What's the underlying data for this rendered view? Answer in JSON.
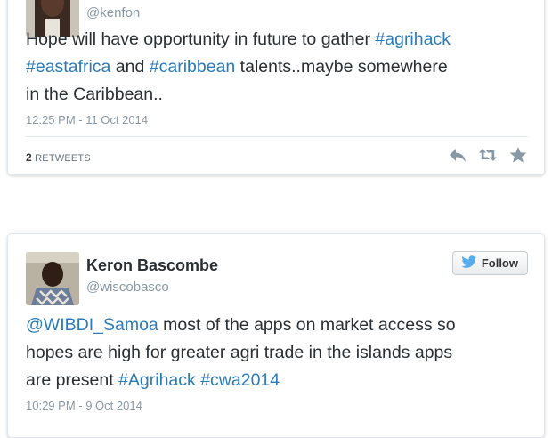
{
  "tweets": [
    {
      "username": "@kenfon",
      "text_parts": [
        {
          "t": "Hope will have opportunity in future to gather ",
          "link": false
        },
        {
          "t": "#agrihack",
          "link": true
        },
        {
          "t": "\n",
          "link": false
        },
        {
          "t": "#eastafrica",
          "link": true
        },
        {
          "t": " and ",
          "link": false
        },
        {
          "t": "#caribbean",
          "link": true
        },
        {
          "t": " talents..maybe somewhere\nin the Caribbean..",
          "link": false
        }
      ],
      "timestamp": "12:25 PM - 11 Oct 2014",
      "retweet_count": "2",
      "retweet_label": "RETWEETS",
      "actions": [
        "reply-icon",
        "retweet-icon",
        "favorite-icon"
      ]
    },
    {
      "display_name": "Keron Bascombe",
      "username": "@wiscobasco",
      "follow_label": "Follow",
      "text_parts": [
        {
          "t": "@WIBDI_Samoa",
          "link": true
        },
        {
          "t": " most of the apps on market access so\nhopes are high for greater agri trade in the islands apps\nare present  ",
          "link": false
        },
        {
          "t": "#Agrihack",
          "link": true
        },
        {
          "t": " ",
          "link": false
        },
        {
          "t": "#cwa2014",
          "link": true
        }
      ],
      "timestamp": "10:29 PM - 9 Oct 2014"
    }
  ],
  "colors": {
    "link": "#2b7bb9",
    "text": "#292f33",
    "muted": "#8899a6",
    "twitter_blue": "#55acee"
  }
}
